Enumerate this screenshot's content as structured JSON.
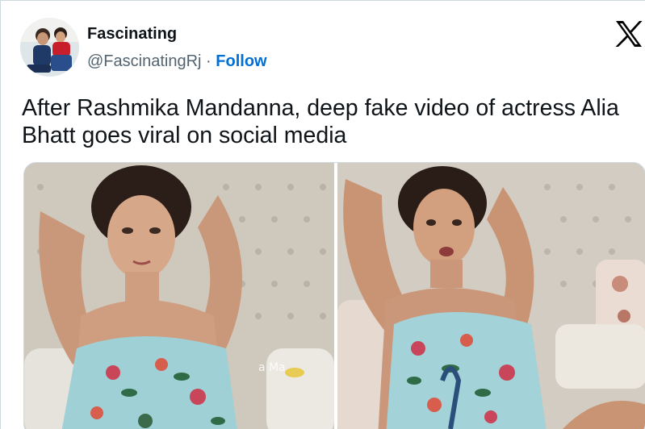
{
  "author": {
    "display_name": "Fascinating",
    "handle": "@FascinatingRj",
    "separator": "·",
    "follow_label": "Follow",
    "avatar_icon": "profile-photo"
  },
  "platform": {
    "logo_icon": "x-logo"
  },
  "tweet": {
    "text": "After Rashmika Mandanna, deep fake video of actress Alia Bhatt goes viral on social media"
  },
  "media": {
    "frame_count": 2,
    "watermark": "a Ma"
  },
  "colors": {
    "text_primary": "#0f1419",
    "text_secondary": "#536471",
    "follow_link": "#006fd6",
    "border": "#cfd9de"
  }
}
